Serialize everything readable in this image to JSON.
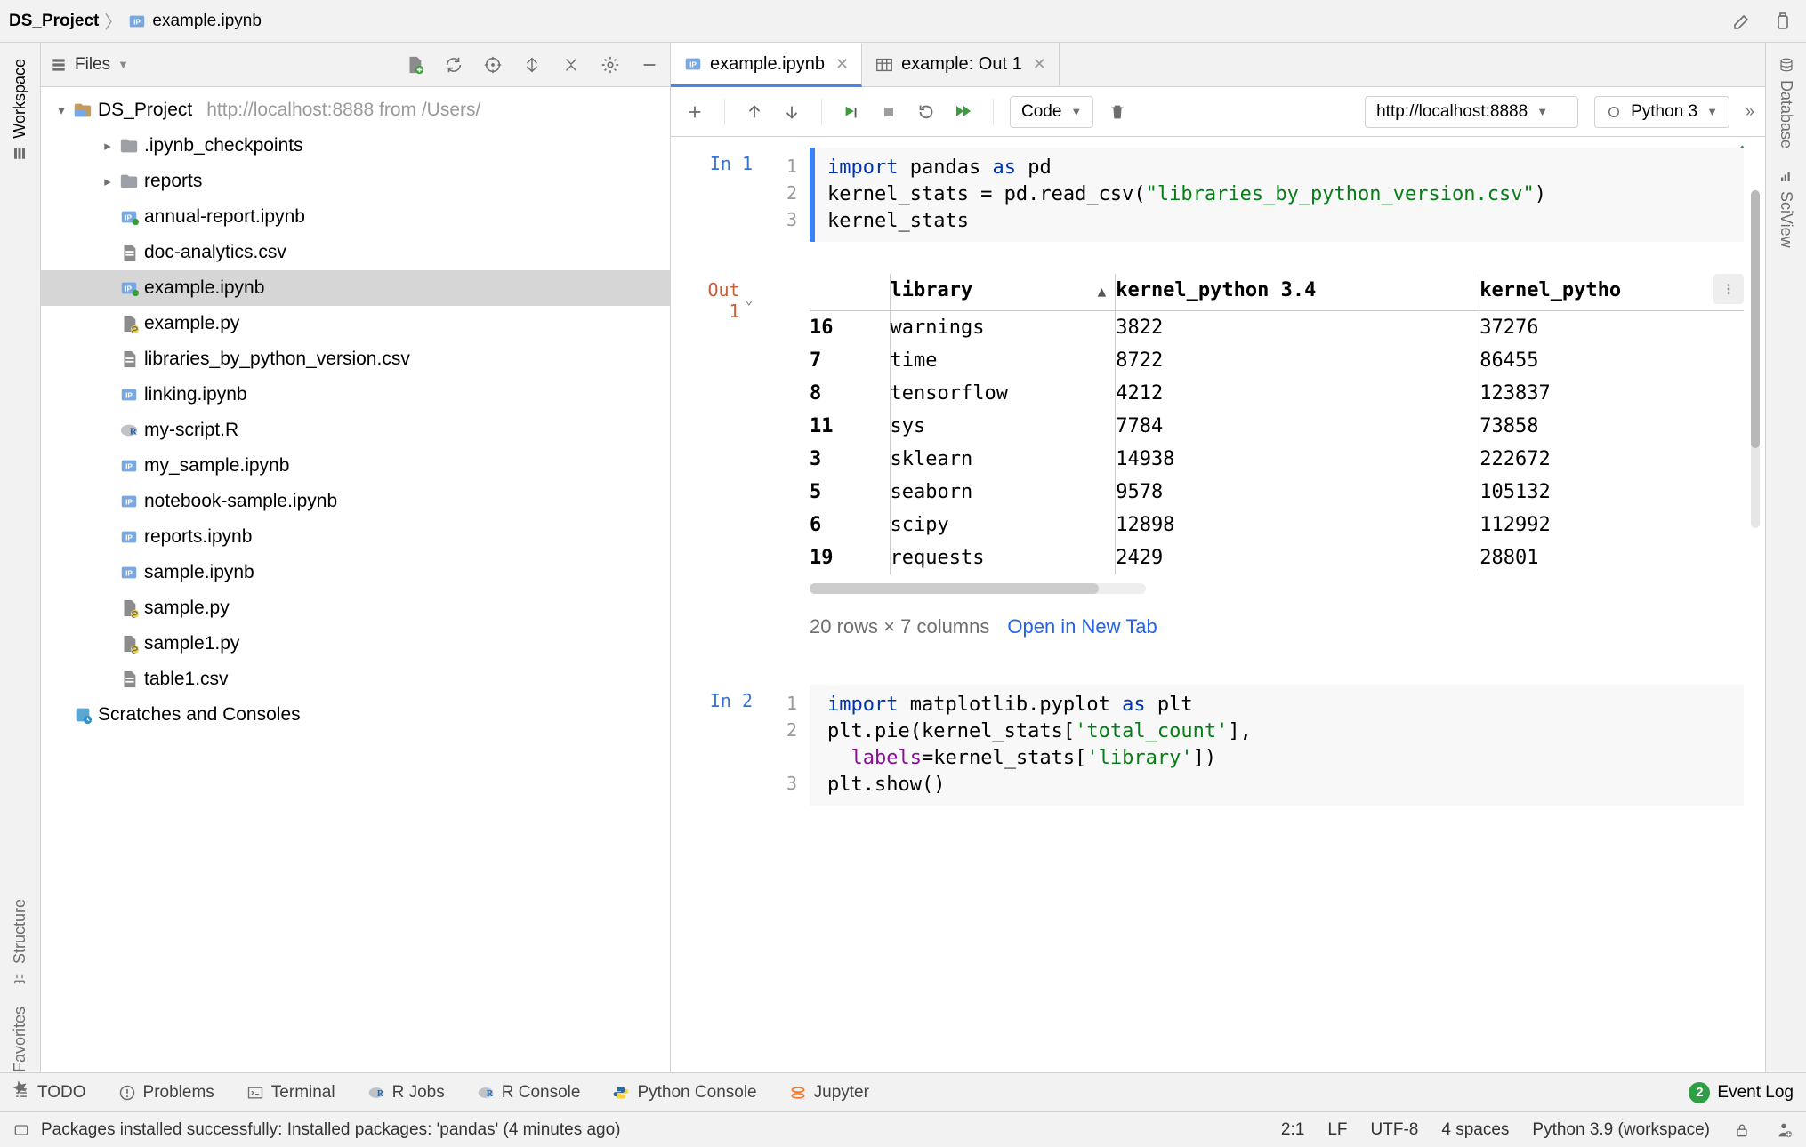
{
  "breadcrumbs": {
    "project": "DS_Project",
    "file": "example.ipynb"
  },
  "tree_toolbar": {
    "view_label": "Files"
  },
  "tree": {
    "root": {
      "name": "DS_Project",
      "hint": "http://localhost:8888 from /Users/"
    },
    "items": [
      {
        "type": "folder",
        "name": ".ipynb_checkpoints",
        "depth": 1,
        "arrow": "closed",
        "icon": "folder"
      },
      {
        "type": "folder",
        "name": "reports",
        "depth": 1,
        "arrow": "closed",
        "icon": "folder"
      },
      {
        "type": "file",
        "name": "annual-report.ipynb",
        "depth": 1,
        "icon": "ipynb-run"
      },
      {
        "type": "file",
        "name": "doc-analytics.csv",
        "depth": 1,
        "icon": "csv"
      },
      {
        "type": "file",
        "name": "example.ipynb",
        "depth": 1,
        "icon": "ipynb-run",
        "selected": true
      },
      {
        "type": "file",
        "name": "example.py",
        "depth": 1,
        "icon": "py"
      },
      {
        "type": "file",
        "name": "libraries_by_python_version.csv",
        "depth": 1,
        "icon": "csv"
      },
      {
        "type": "file",
        "name": "linking.ipynb",
        "depth": 1,
        "icon": "ipynb"
      },
      {
        "type": "file",
        "name": "my-script.R",
        "depth": 1,
        "icon": "r"
      },
      {
        "type": "file",
        "name": "my_sample.ipynb",
        "depth": 1,
        "icon": "ipynb"
      },
      {
        "type": "file",
        "name": "notebook-sample.ipynb",
        "depth": 1,
        "icon": "ipynb"
      },
      {
        "type": "file",
        "name": "reports.ipynb",
        "depth": 1,
        "icon": "ipynb"
      },
      {
        "type": "file",
        "name": "sample.ipynb",
        "depth": 1,
        "icon": "ipynb"
      },
      {
        "type": "file",
        "name": "sample.py",
        "depth": 1,
        "icon": "py"
      },
      {
        "type": "file",
        "name": "sample1.py",
        "depth": 1,
        "icon": "py"
      },
      {
        "type": "file",
        "name": "table1.csv",
        "depth": 1,
        "icon": "csv"
      }
    ],
    "scratches": "Scratches and Consoles"
  },
  "left_rail": {
    "top": [
      {
        "label": "Workspace",
        "icon": "workspace-icon",
        "active": true
      }
    ],
    "bottom": [
      {
        "label": "Structure",
        "icon": "structure-icon"
      },
      {
        "label": "Favorites",
        "icon": "star-icon"
      }
    ]
  },
  "right_rail": {
    "items": [
      {
        "label": "Database",
        "icon": "database-icon"
      },
      {
        "label": "SciView",
        "icon": "sciview-icon"
      }
    ]
  },
  "editor_tabs": [
    {
      "label": "example.ipynb",
      "icon": "ipynb",
      "active": true
    },
    {
      "label": "example: Out 1",
      "icon": "table",
      "active": false
    }
  ],
  "notebook_toolbar": {
    "cell_type": "Code",
    "server": "http://localhost:8888",
    "kernel": "Python 3"
  },
  "cells": {
    "in1": {
      "prompt": "In 1",
      "gutter": [
        "1",
        "2",
        "3"
      ]
    },
    "out1": {
      "prompt": "Out 1",
      "summary_dim": "20 rows × 7 columns",
      "summary_link": "Open in New Tab"
    },
    "in2": {
      "prompt": "In 2",
      "gutter": [
        "1",
        "2",
        "",
        "3"
      ]
    }
  },
  "chart_data": {
    "type": "table",
    "title": "",
    "columns": [
      "",
      "library",
      "kernel_python 3.4",
      "kernel_pytho"
    ],
    "rows": [
      [
        "16",
        "warnings",
        "3822",
        "37276"
      ],
      [
        "7",
        "time",
        "8722",
        "86455"
      ],
      [
        "8",
        "tensorflow",
        "4212",
        "123837"
      ],
      [
        "11",
        "sys",
        "7784",
        "73858"
      ],
      [
        "3",
        "sklearn",
        "14938",
        "222672"
      ],
      [
        "5",
        "seaborn",
        "9578",
        "105132"
      ],
      [
        "6",
        "scipy",
        "12898",
        "112992"
      ],
      [
        "19",
        "requests",
        "2429",
        "28801"
      ]
    ],
    "total_rows": 20,
    "total_columns": 7
  },
  "tool_windows": {
    "items": [
      {
        "label": "TODO",
        "icon": "todo-icon"
      },
      {
        "label": "Problems",
        "icon": "warning-icon"
      },
      {
        "label": "Terminal",
        "icon": "terminal-icon"
      },
      {
        "label": "R Jobs",
        "icon": "r-icon"
      },
      {
        "label": "R Console",
        "icon": "r-icon"
      },
      {
        "label": "Python Console",
        "icon": "python-icon"
      },
      {
        "label": "Jupyter",
        "icon": "jupyter-icon"
      }
    ],
    "event_log": {
      "count": "2",
      "label": "Event Log"
    }
  },
  "status_bar": {
    "message": "Packages installed successfully: Installed packages: 'pandas' (4 minutes ago)",
    "caret": "2:1",
    "line_sep": "LF",
    "encoding": "UTF-8",
    "indent": "4 spaces",
    "interpreter": "Python 3.9 (workspace)"
  }
}
